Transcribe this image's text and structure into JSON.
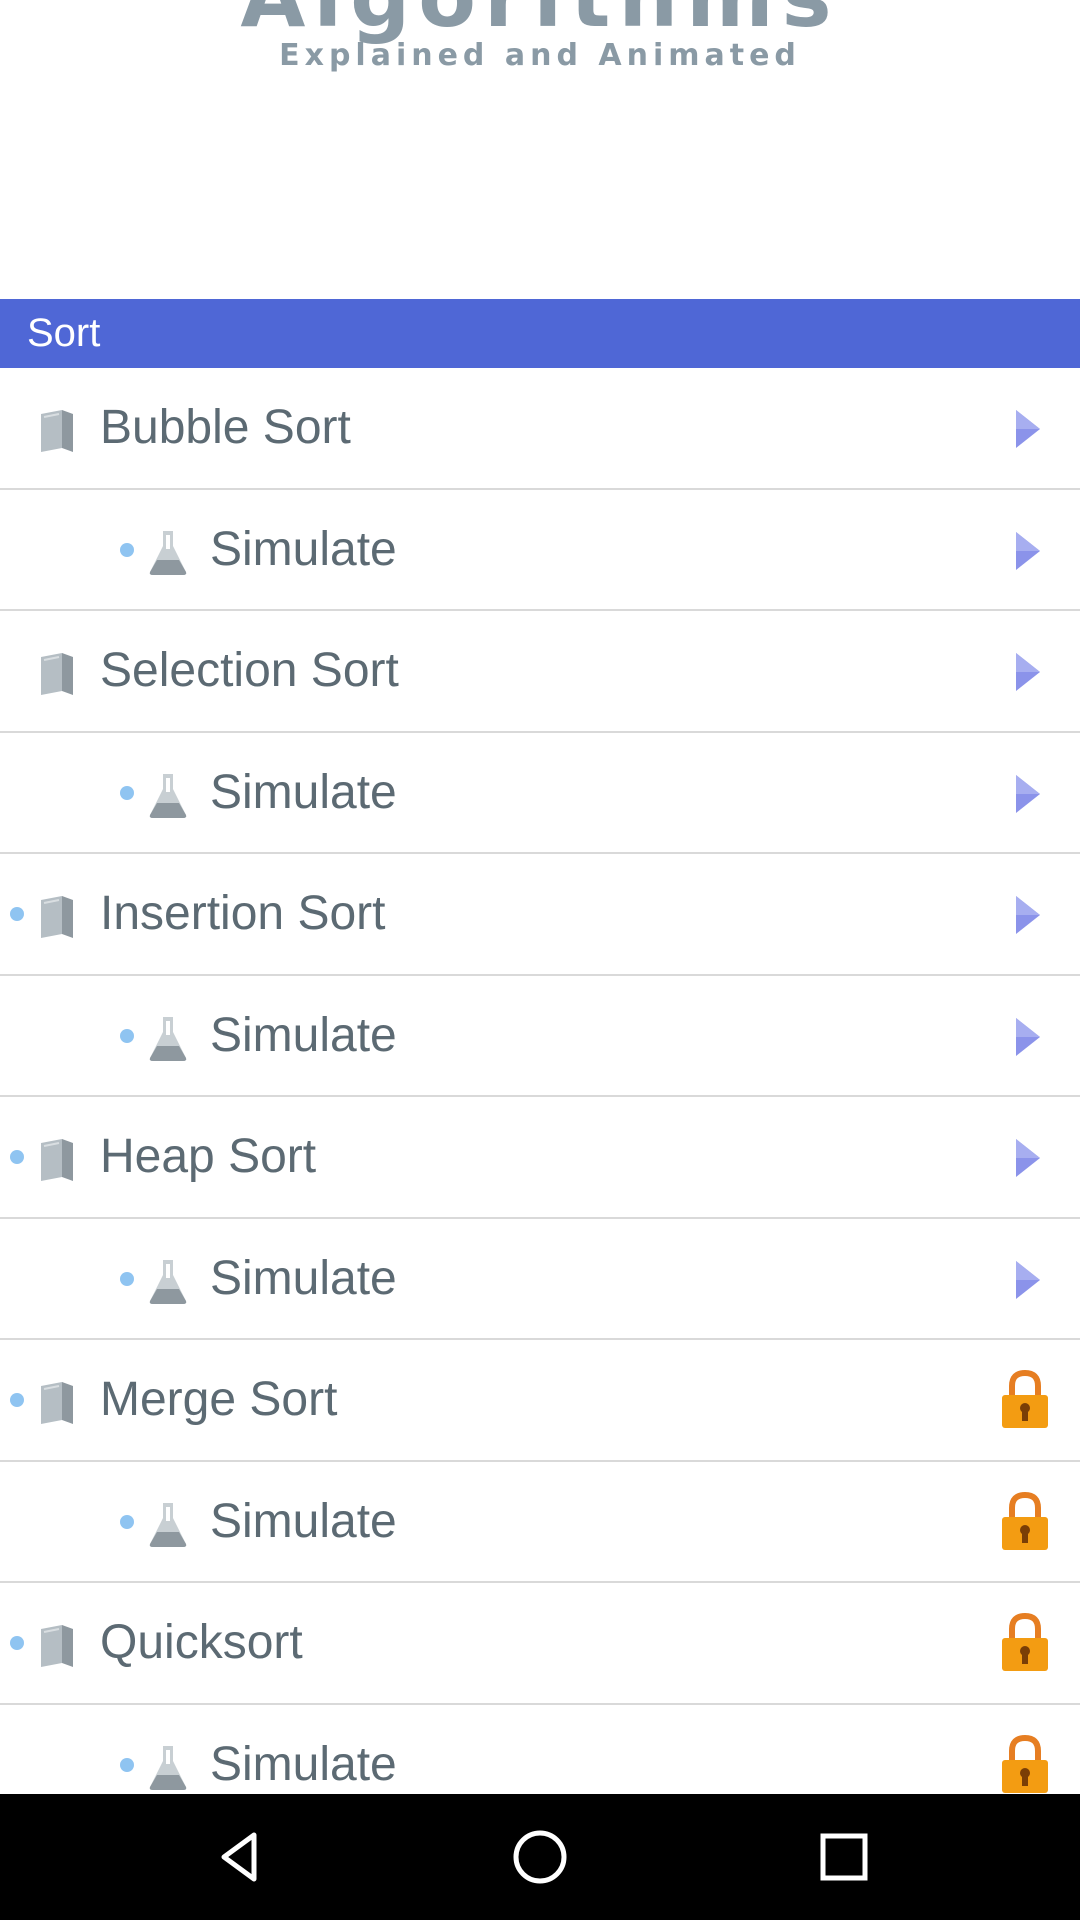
{
  "header": {
    "title": "Algorithms",
    "subtitle": "Explained and Animated"
  },
  "section": {
    "label": "Sort"
  },
  "rows": [
    {
      "kind": "algorithm",
      "label": "Bubble Sort",
      "state": "open"
    },
    {
      "kind": "simulate",
      "label": "Simulate",
      "state": "open"
    },
    {
      "kind": "algorithm",
      "label": "Selection Sort",
      "state": "open"
    },
    {
      "kind": "simulate",
      "label": "Simulate",
      "state": "open"
    },
    {
      "kind": "algorithm",
      "label": "Insertion Sort",
      "state": "open"
    },
    {
      "kind": "simulate",
      "label": "Simulate",
      "state": "open"
    },
    {
      "kind": "algorithm",
      "label": "Heap Sort",
      "state": "open"
    },
    {
      "kind": "simulate",
      "label": "Simulate",
      "state": "open"
    },
    {
      "kind": "algorithm",
      "label": "Merge Sort",
      "state": "locked"
    },
    {
      "kind": "simulate",
      "label": "Simulate",
      "state": "locked"
    },
    {
      "kind": "algorithm",
      "label": "Quicksort",
      "state": "locked"
    },
    {
      "kind": "simulate",
      "label": "Simulate",
      "state": "locked"
    }
  ],
  "icons": {
    "algorithm": "book-icon",
    "simulate": "flask-icon",
    "open": "play-arrow-icon",
    "locked": "lock-icon"
  },
  "colors": {
    "section_bar": "#4f67d6",
    "arrow": "#8b93ea",
    "lock": "#f39c12",
    "bullet": "#8fc4f1",
    "text": "#5c6a73"
  },
  "navbar": {
    "buttons": [
      "back-button",
      "home-button",
      "recents-button"
    ]
  }
}
